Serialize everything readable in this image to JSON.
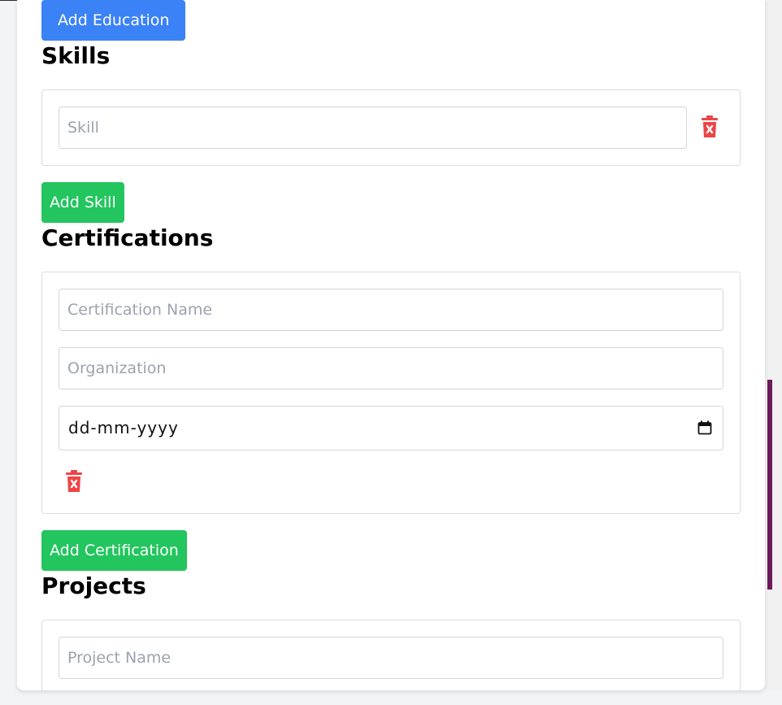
{
  "education": {
    "add_button_label": "Add Education"
  },
  "skills": {
    "heading": "Skills",
    "skill_placeholder": "Skill",
    "add_button_label": "Add Skill"
  },
  "certifications": {
    "heading": "Certifications",
    "name_placeholder": "Certification Name",
    "organization_placeholder": "Organization",
    "date_value": "dd-mm-yyyy",
    "add_button_label": "Add Certification"
  },
  "projects": {
    "heading": "Projects",
    "name_placeholder": "Project Name"
  },
  "icons": {
    "delete": "trash-icon",
    "calendar": "calendar-icon"
  },
  "colors": {
    "primary_blue": "#3b82f6",
    "success_green": "#22c55e",
    "danger_red": "#ef4444"
  }
}
